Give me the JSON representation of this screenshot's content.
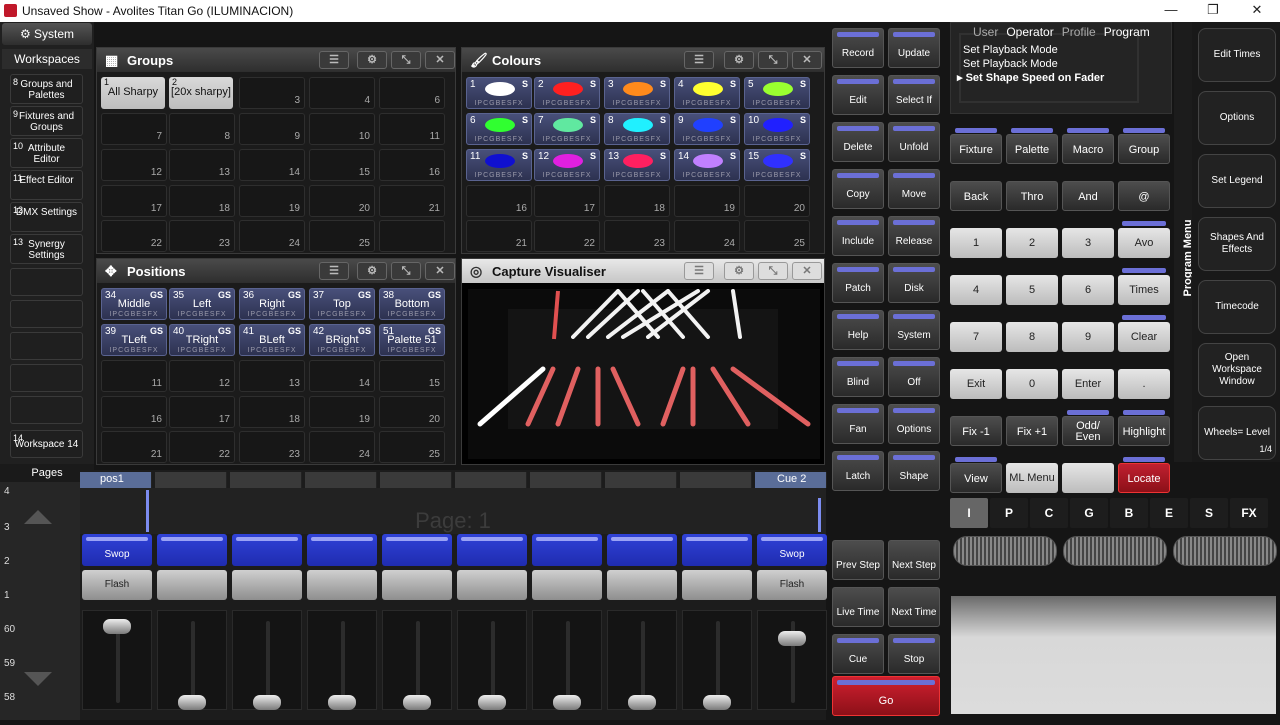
{
  "window": {
    "title": "Unsaved Show - Avolites Titan Go (ILUMINACION)",
    "minimize": "—",
    "maximize": "❐",
    "close": "✕"
  },
  "sidebar": {
    "system": "System",
    "workspaces": "Workspaces",
    "items": [
      {
        "num": "8",
        "label": "Groups and Palettes"
      },
      {
        "num": "9",
        "label": "Fixtures and Groups"
      },
      {
        "num": "10",
        "label": "Attribute Editor"
      },
      {
        "num": "11",
        "label": "Effect Editor"
      },
      {
        "num": "12",
        "label": "DMX Settings"
      },
      {
        "num": "13",
        "label": "Synergy Settings"
      }
    ],
    "workspace_bottom": {
      "num": "14",
      "label": "Workspace 14"
    },
    "pages_label": "Pages",
    "page_numbers": [
      "4",
      "3",
      "2",
      "1",
      "60",
      "59",
      "58"
    ]
  },
  "groups": {
    "title": "Groups",
    "items": [
      {
        "num": "1",
        "label": "All Sharpy"
      },
      {
        "num": "2",
        "label": "[20x sharpy]"
      }
    ],
    "empty_numbers": [
      "3",
      "4",
      "6",
      "7",
      "8",
      "9",
      "10",
      "11",
      "12",
      "13",
      "14",
      "15",
      "16",
      "17",
      "18",
      "19",
      "20",
      "21",
      "22",
      "23",
      "24",
      "25"
    ]
  },
  "colours": {
    "title": "Colours",
    "flags": "IPCGBESFX",
    "items": [
      {
        "num": "1",
        "color": "#ffffff"
      },
      {
        "num": "2",
        "color": "#ff2020"
      },
      {
        "num": "3",
        "color": "#ff8a1c"
      },
      {
        "num": "4",
        "color": "#ffff30"
      },
      {
        "num": "5",
        "color": "#9aff30"
      },
      {
        "num": "6",
        "color": "#30ff30"
      },
      {
        "num": "7",
        "color": "#60e8a0"
      },
      {
        "num": "8",
        "color": "#20f0ff"
      },
      {
        "num": "9",
        "color": "#2040ff"
      },
      {
        "num": "10",
        "color": "#2020ff"
      },
      {
        "num": "11",
        "color": "#1010d0"
      },
      {
        "num": "12",
        "color": "#e020e0"
      },
      {
        "num": "13",
        "color": "#ff2060"
      },
      {
        "num": "14",
        "color": "#c080ff"
      },
      {
        "num": "15",
        "color": "#3030ff"
      }
    ],
    "empty_numbers": [
      "16",
      "17",
      "18",
      "19",
      "20",
      "21",
      "22",
      "23",
      "24",
      "25"
    ]
  },
  "positions": {
    "title": "Positions",
    "flags": "IPCGBESFX",
    "items": [
      {
        "num": "34",
        "label": "Middle"
      },
      {
        "num": "35",
        "label": "Left"
      },
      {
        "num": "36",
        "label": "Right"
      },
      {
        "num": "37",
        "label": "Top"
      },
      {
        "num": "38",
        "label": "Bottom"
      },
      {
        "num": "39",
        "label": "TLeft"
      },
      {
        "num": "40",
        "label": "TRight"
      },
      {
        "num": "41",
        "label": "BLeft"
      },
      {
        "num": "42",
        "label": "BRight"
      },
      {
        "num": "51",
        "label": "Palette 51"
      }
    ],
    "empty_numbers": [
      "11",
      "12",
      "13",
      "14",
      "15",
      "16",
      "17",
      "18",
      "19",
      "20",
      "21",
      "22",
      "23",
      "24",
      "25"
    ]
  },
  "visualiser": {
    "title": "Capture Visualiser"
  },
  "playbacks": {
    "pos1": "pos1",
    "cue2": "Cue 2",
    "page_text": "Page: 1",
    "swop": "Swop",
    "flash": "Flash"
  },
  "command_buttons": [
    [
      "Record",
      "Update"
    ],
    [
      "Edit",
      "Select If"
    ],
    [
      "Delete",
      "Unfold"
    ],
    [
      "Copy",
      "Move"
    ],
    [
      "Include",
      "Release"
    ],
    [
      "Patch",
      "Disk"
    ],
    [
      "Help",
      "System"
    ],
    [
      "Blind",
      "Off"
    ],
    [
      "Fan",
      "Options"
    ],
    [
      "Latch",
      "Shape"
    ]
  ],
  "playback_ctrl": {
    "prev_step": "Prev Step",
    "next_step": "Next Step",
    "live_time": "Live Time",
    "next_time": "Next Time",
    "cue": "Cue",
    "stop": "Stop",
    "go": "Go"
  },
  "prompt": {
    "tabs": [
      "User",
      "Operator",
      "Profile",
      "Program"
    ],
    "lines": [
      "Set Playback Mode",
      "Set Playback Mode",
      "Set Shape Speed on Fader"
    ]
  },
  "keypad": {
    "row1": [
      "Fixture",
      "Palette",
      "Macro",
      "Group"
    ],
    "row2": [
      "Back",
      "Thro",
      "And",
      "@"
    ],
    "num_rows": [
      [
        "1",
        "2",
        "3",
        "Avo"
      ],
      [
        "4",
        "5",
        "6",
        "Times"
      ],
      [
        "7",
        "8",
        "9",
        "Clear"
      ],
      [
        "Exit",
        "0",
        "Enter",
        "."
      ]
    ],
    "row_fix": [
      "Fix -1",
      "Fix +1",
      "Odd/ Even",
      "Highlight"
    ],
    "row_view": [
      "View",
      "ML Menu",
      "",
      "Locate"
    ]
  },
  "attribute_tabs": [
    "I",
    "P",
    "C",
    "G",
    "B",
    "E",
    "S",
    "FX"
  ],
  "program_menu": {
    "vertical_label": "Program Menu",
    "items": [
      "Edit Times",
      "Options",
      "Set Legend",
      "Shapes And Effects",
      "Timecode",
      "Open Workspace Window",
      "Wheels= Level"
    ],
    "page": "1/4"
  }
}
